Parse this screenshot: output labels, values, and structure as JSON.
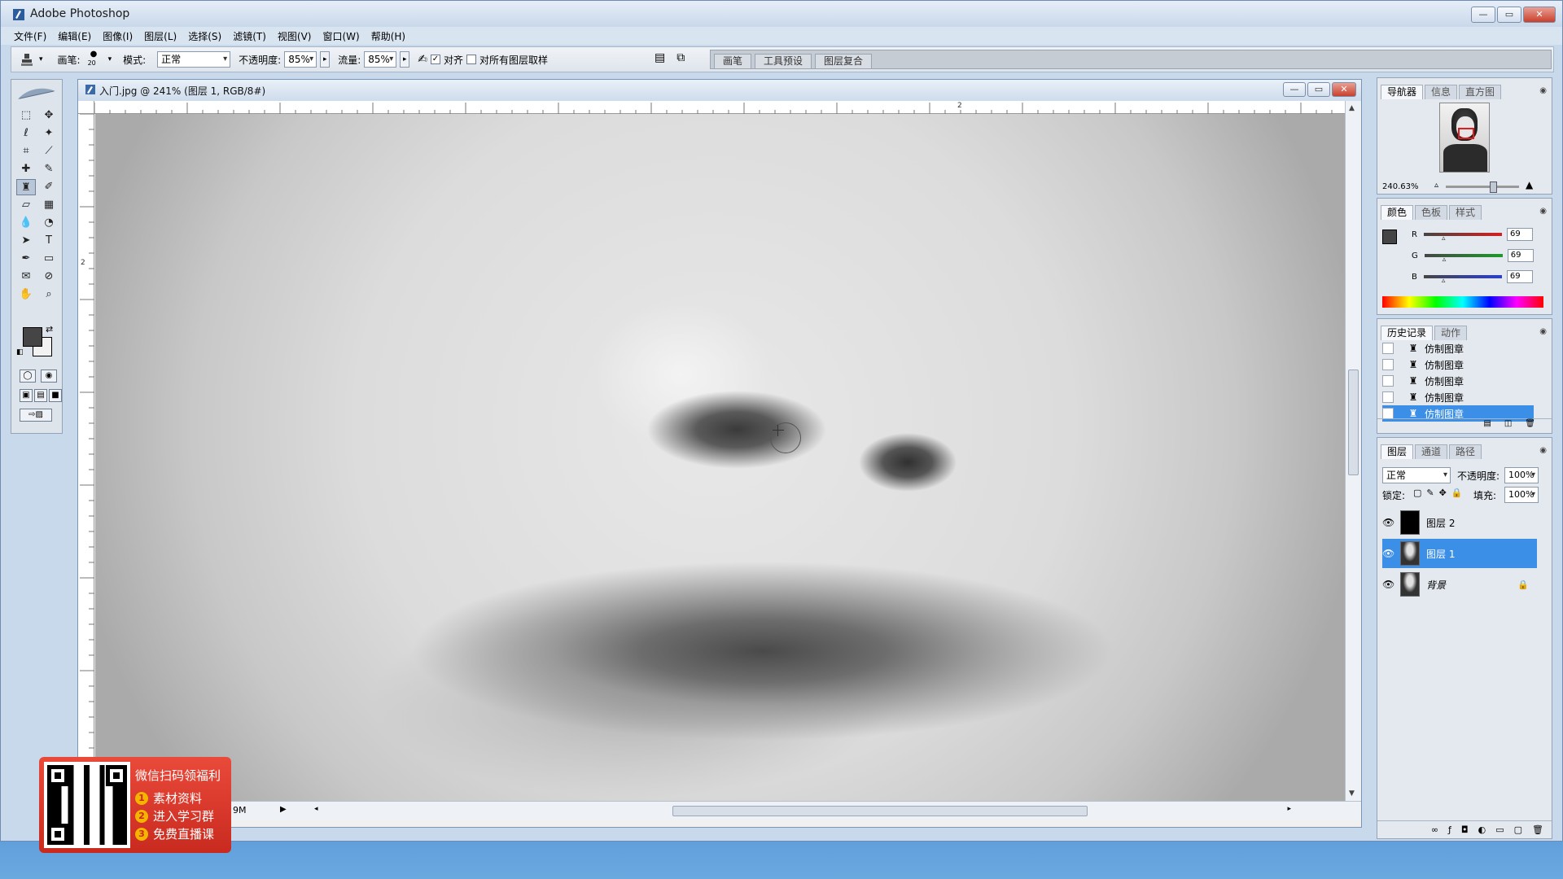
{
  "app": {
    "title": "Adobe Photoshop"
  },
  "window_controls": {
    "min": "—",
    "max": "▭",
    "close": "✕"
  },
  "menu": [
    "文件(F)",
    "编辑(E)",
    "图像(I)",
    "图层(L)",
    "选择(S)",
    "滤镜(T)",
    "视图(V)",
    "窗口(W)",
    "帮助(H)"
  ],
  "options": {
    "brush_label": "画笔:",
    "brush_size": "20",
    "mode_label": "模式:",
    "mode_value": "正常",
    "opacity_label": "不透明度:",
    "opacity_value": "85%",
    "flow_label": "流量:",
    "flow_value": "85%",
    "aligned_label": "对齐",
    "aligned_checked": true,
    "sample_all_label": "对所有图层取样",
    "sample_all_checked": false,
    "well_tabs": [
      "画笔",
      "工具预设",
      "图层复合"
    ]
  },
  "document": {
    "title": "入门.jpg @ 241% (图层 1, RGB/8#)",
    "ruler_top_label": "2",
    "ruler_left_label": "2",
    "status_size": "9M"
  },
  "navigator": {
    "tabs": [
      "导航器",
      "信息",
      "直方图"
    ],
    "active_tab": 0,
    "zoom": "240.63%"
  },
  "color_panel": {
    "tabs": [
      "颜色",
      "色板",
      "样式"
    ],
    "active_tab": 0,
    "foreground": "#454545",
    "channels": [
      {
        "name": "R",
        "value": "69",
        "color": "#d42020"
      },
      {
        "name": "G",
        "value": "69",
        "color": "#1e9a2a"
      },
      {
        "name": "B",
        "value": "69",
        "color": "#2a3fd0"
      }
    ]
  },
  "history": {
    "tabs": [
      "历史记录",
      "动作"
    ],
    "active_tab": 0,
    "items": [
      "仿制图章",
      "仿制图章",
      "仿制图章",
      "仿制图章",
      "仿制图章"
    ],
    "selected_index": 4
  },
  "layers": {
    "tabs": [
      "图层",
      "通道",
      "路径"
    ],
    "active_tab": 0,
    "blend_mode": "正常",
    "opacity_label": "不透明度:",
    "opacity": "100%",
    "lock_label": "锁定:",
    "fill_label": "填充:",
    "fill": "100%",
    "items": [
      {
        "name": "图层 2",
        "thumb": "black",
        "selected": false,
        "locked": false
      },
      {
        "name": "图层 1",
        "thumb": "portrait",
        "selected": true,
        "locked": false
      },
      {
        "name": "背景",
        "thumb": "portrait",
        "selected": false,
        "locked": true
      }
    ]
  },
  "promo": {
    "title": "微信扫码领福利",
    "lines": [
      {
        "num": "1",
        "text": "素材资料"
      },
      {
        "num": "2",
        "text": "进入学习群"
      },
      {
        "num": "3",
        "text": "免费直播课"
      }
    ]
  },
  "colors": {
    "selection_blue": "#3b8fe6",
    "promo_red": "#d8332a"
  }
}
